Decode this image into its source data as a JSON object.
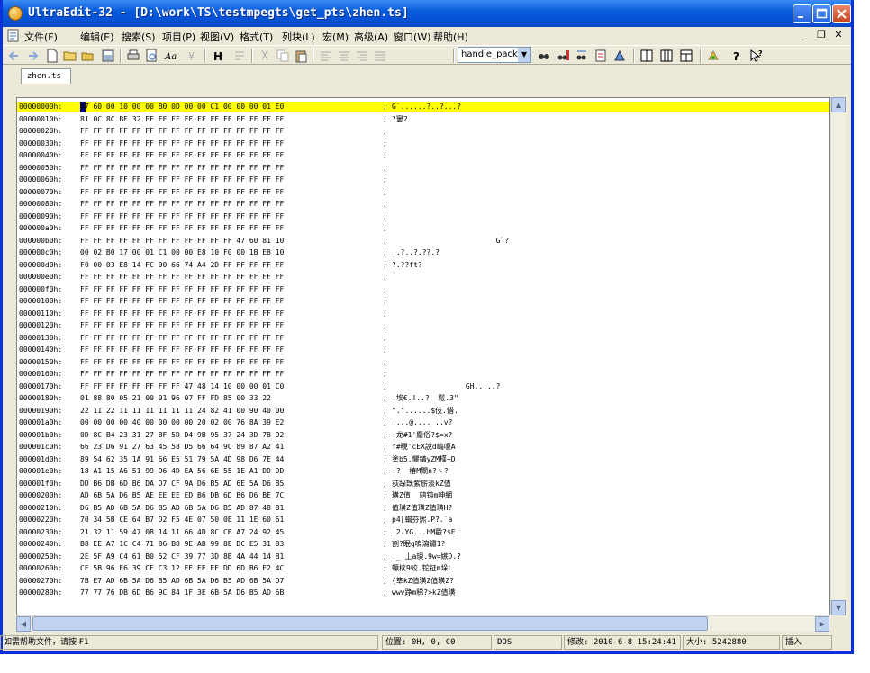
{
  "window": {
    "title": "UltraEdit-32 - [D:\\work\\TS\\testmpegts\\get_pts\\zhen.ts]"
  },
  "menu": [
    "文件(F)",
    "编辑(E)",
    "搜索(S)",
    "项目(P)",
    "视图(V)",
    "格式(T)",
    "列块(L)",
    "宏(M)",
    "高级(A)",
    "窗口(W)",
    "帮助(H)"
  ],
  "toolbar": {
    "function_list": "handle_packet"
  },
  "tabs": [
    {
      "label": "zhen.ts"
    }
  ],
  "hex_rows": [
    {
      "addr": "00000000h:",
      "hex": "47 60 00 10 00 00 B0 0D 00 00 C1 00 00 00 01 E0",
      "ascii": "G`......?..?...?"
    },
    {
      "addr": "00000010h:",
      "hex": "81 0C 8C BE 32 FF FF FF FF FF FF FF FF FF FF FF",
      "ascii": "?窶2"
    },
    {
      "addr": "00000020h:",
      "hex": "FF FF FF FF FF FF FF FF FF FF FF FF FF FF FF FF",
      "ascii": ""
    },
    {
      "addr": "00000030h:",
      "hex": "FF FF FF FF FF FF FF FF FF FF FF FF FF FF FF FF",
      "ascii": ""
    },
    {
      "addr": "00000040h:",
      "hex": "FF FF FF FF FF FF FF FF FF FF FF FF FF FF FF FF",
      "ascii": ""
    },
    {
      "addr": "00000050h:",
      "hex": "FF FF FF FF FF FF FF FF FF FF FF FF FF FF FF FF",
      "ascii": ""
    },
    {
      "addr": "00000060h:",
      "hex": "FF FF FF FF FF FF FF FF FF FF FF FF FF FF FF FF",
      "ascii": ""
    },
    {
      "addr": "00000070h:",
      "hex": "FF FF FF FF FF FF FF FF FF FF FF FF FF FF FF FF",
      "ascii": ""
    },
    {
      "addr": "00000080h:",
      "hex": "FF FF FF FF FF FF FF FF FF FF FF FF FF FF FF FF",
      "ascii": ""
    },
    {
      "addr": "00000090h:",
      "hex": "FF FF FF FF FF FF FF FF FF FF FF FF FF FF FF FF",
      "ascii": ""
    },
    {
      "addr": "000000a0h:",
      "hex": "FF FF FF FF FF FF FF FF FF FF FF FF FF FF FF FF",
      "ascii": ""
    },
    {
      "addr": "000000b0h:",
      "hex": "FF FF FF FF FF FF FF FF FF FF FF FF 47 60 81 10",
      "ascii": "                        G`?"
    },
    {
      "addr": "000000c0h:",
      "hex": "00 02 B0 17 00 01 C1 00 00 E8 10 F0 00 1B E8 10",
      "ascii": "..?..?.??.?"
    },
    {
      "addr": "000000d0h:",
      "hex": "F0 00 03 E8 14 FC 00 66 74 A4 2D FF FF FF FF FF",
      "ascii": "?.??ft?"
    },
    {
      "addr": "000000e0h:",
      "hex": "FF FF FF FF FF FF FF FF FF FF FF FF FF FF FF FF",
      "ascii": ""
    },
    {
      "addr": "000000f0h:",
      "hex": "FF FF FF FF FF FF FF FF FF FF FF FF FF FF FF FF",
      "ascii": ""
    },
    {
      "addr": "00000100h:",
      "hex": "FF FF FF FF FF FF FF FF FF FF FF FF FF FF FF FF",
      "ascii": ""
    },
    {
      "addr": "00000110h:",
      "hex": "FF FF FF FF FF FF FF FF FF FF FF FF FF FF FF FF",
      "ascii": ""
    },
    {
      "addr": "00000120h:",
      "hex": "FF FF FF FF FF FF FF FF FF FF FF FF FF FF FF FF",
      "ascii": ""
    },
    {
      "addr": "00000130h:",
      "hex": "FF FF FF FF FF FF FF FF FF FF FF FF FF FF FF FF",
      "ascii": ""
    },
    {
      "addr": "00000140h:",
      "hex": "FF FF FF FF FF FF FF FF FF FF FF FF FF FF FF FF",
      "ascii": ""
    },
    {
      "addr": "00000150h:",
      "hex": "FF FF FF FF FF FF FF FF FF FF FF FF FF FF FF FF",
      "ascii": ""
    },
    {
      "addr": "00000160h:",
      "hex": "FF FF FF FF FF FF FF FF FF FF FF FF FF FF FF FF",
      "ascii": ""
    },
    {
      "addr": "00000170h:",
      "hex": "FF FF FF FF FF FF FF FF 47 48 14 10 00 00 01 C0",
      "ascii": "                 GH.....?"
    },
    {
      "addr": "00000180h:",
      "hex": "01 88 80 05 21 00 01 96 07 FF FD 85 00 33 22",
      "ascii": ".埃€.!..?  鬆.3\""
    },
    {
      "addr": "00000190h:",
      "hex": "22 11 22 11 11 11 11 11 11 24 82 41 00 90 40 00",
      "ascii": "\".\"......$伎.惜."
    },
    {
      "addr": "000001a0h:",
      "hex": "00 00 00 00 40 00 00 00 00 20 02 00 76 8A 39 E2",
      "ascii": "....@.... ..v?"
    },
    {
      "addr": "000001b0h:",
      "hex": "0D 8C B4 23 31 27 8F 5D D4 9B 95 37 24 3D 78 92",
      "ascii": ".龙#1'鏖俗?$=x?"
    },
    {
      "addr": "000001c0h:",
      "hex": "66 23 D6 91 27 63 45 58 D5 66 64 9C 89 87 A2 41",
      "ascii": "f#覗'cEX說d嶋嗄A"
    },
    {
      "addr": "000001d0h:",
      "hex": "89 54 62 35 1A 91 66 E5 51 79 5A 4D 98 D6 7E 44",
      "ascii": "塗b5.懼錆yZM槿~D"
    },
    {
      "addr": "000001e0h:",
      "hex": "18 A1 15 A6 51 99 96 4D EA 56 6E 55 1E A1 DD DD",
      "ascii": ".?  椿M閘n?ヽ?"
    },
    {
      "addr": "000001f0h:",
      "hex": "DD B6 DB 6D B6 DA D7 CF 9A D6 B5 AD 6E 5A D6 B5",
      "ascii": "荻跺旣紫旂淡kZ值"
    },
    {
      "addr": "00000200h:",
      "hex": "AD 6B 5A D6 B5 AE EE EE ED B6 DB 6D B6 D6 BE 7C",
      "ascii": "璜Z值  鸫钝m呻網"
    },
    {
      "addr": "00000210h:",
      "hex": "D6 B5 AD 6B 5A D6 B5 AD 6B 5A D6 B5 AD 87 48 81",
      "ascii": "值璜Z值璜Z值璜H?"
    },
    {
      "addr": "00000220h:",
      "hex": "70 34 5B CE 64 B7 D2 F5 4E 07 50 0E 11 1E 60 61",
      "ascii": "p4[蝟芬熈.P?.`a"
    },
    {
      "addr": "00000230h:",
      "hex": "21 32 11 59 47 08 14 11 66 4D 8C CB A7 24 92 45",
      "ascii": "!2.YG...hM戳?$E"
    },
    {
      "addr": "00000240h:",
      "hex": "B8 EE A7 1C C4 71 86 B8 9E AB 99 8E DC E5 31 83",
      "ascii": "割?眠q嗚瀉鏽1?"
    },
    {
      "addr": "00000250h:",
      "hex": "2E 5F A9 C4 61 B0 52 CF 39 77 3D 8B 4A 44 14 B1",
      "ascii": "._ 丄a珼.9w=嫉D.?"
    },
    {
      "addr": "00000260h:",
      "hex": "CE 5B 96 E6 39 CE C3 12 EE EE EE DD 6D B6 E2 4C",
      "ascii": "蟩栨9蛟.铊钲m垛L"
    },
    {
      "addr": "00000270h:",
      "hex": "7B E7 AD 6B 5A D6 B5 AD 6B 5A D6 B5 AD 6B 5A D7",
      "ascii": "{筚kZ值璜Z值璜Z?"
    },
    {
      "addr": "00000280h:",
      "hex": "77 77 76 DB 6D B6 9C 84 1F 3E 6B 5A D6 B5 AD 6B",
      "ascii": "wwv踭m稊?>kZ值璜"
    }
  ],
  "status": {
    "help": "如需帮助文件，请按 F1",
    "position": "位置: 0H, 0, C0",
    "format": "DOS",
    "modified": "修改: 2010-6-8 15:24:41",
    "size": "大小: 5242880",
    "mode": "插入"
  }
}
